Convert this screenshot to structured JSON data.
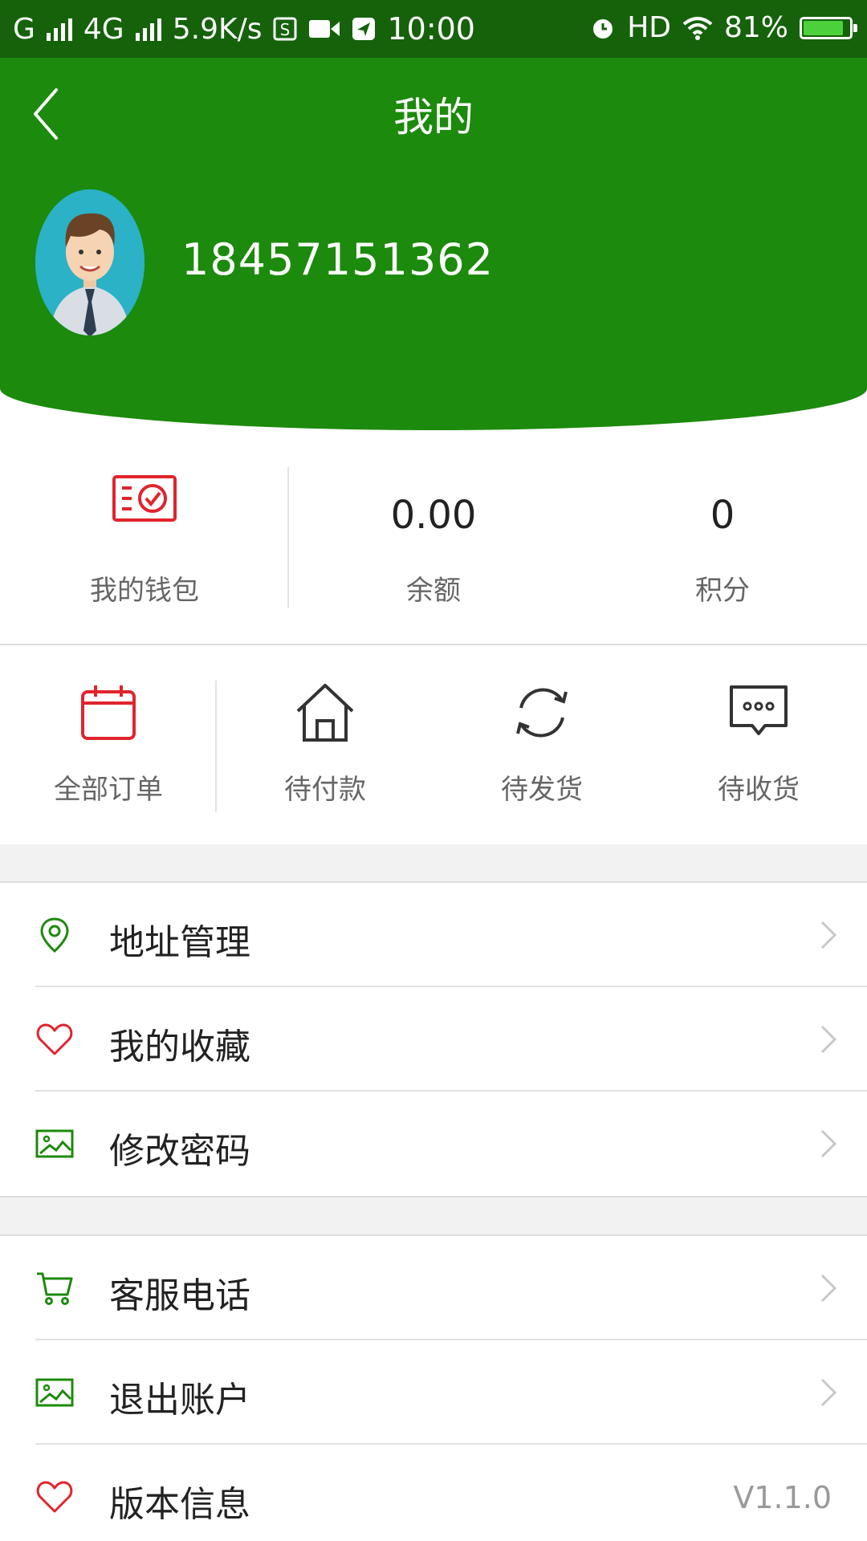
{
  "status_bar": {
    "network_1": "G",
    "network_2": "4G",
    "speed": "5.9K/s",
    "time": "10:00",
    "hd": "HD",
    "battery": "81%"
  },
  "header": {
    "title": "我的",
    "phone": "18457151362"
  },
  "wallet": {
    "wallet_label": "我的钱包",
    "balance_value": "0.00",
    "balance_label": "余额",
    "points_value": "0",
    "points_label": "积分"
  },
  "orders": [
    {
      "label": "全部订单",
      "icon": "calendar-icon"
    },
    {
      "label": "待付款",
      "icon": "house-icon"
    },
    {
      "label": "待发货",
      "icon": "refresh-icon"
    },
    {
      "label": "待收货",
      "icon": "chat-bubble-icon"
    }
  ],
  "menu_group_1": [
    {
      "label": "地址管理",
      "icon": "location-pin-icon"
    },
    {
      "label": "我的收藏",
      "icon": "heart-icon"
    },
    {
      "label": "修改密码",
      "icon": "image-icon"
    }
  ],
  "menu_group_2": [
    {
      "label": "客服电话",
      "icon": "cart-icon"
    },
    {
      "label": "退出账户",
      "icon": "image-icon"
    },
    {
      "label": "版本信息",
      "icon": "heart-icon",
      "value": "V1.1.0"
    }
  ],
  "colors": {
    "brand_green": "#1c8a0c",
    "status_bar": "#15620b",
    "accent_red": "#e0242c"
  }
}
